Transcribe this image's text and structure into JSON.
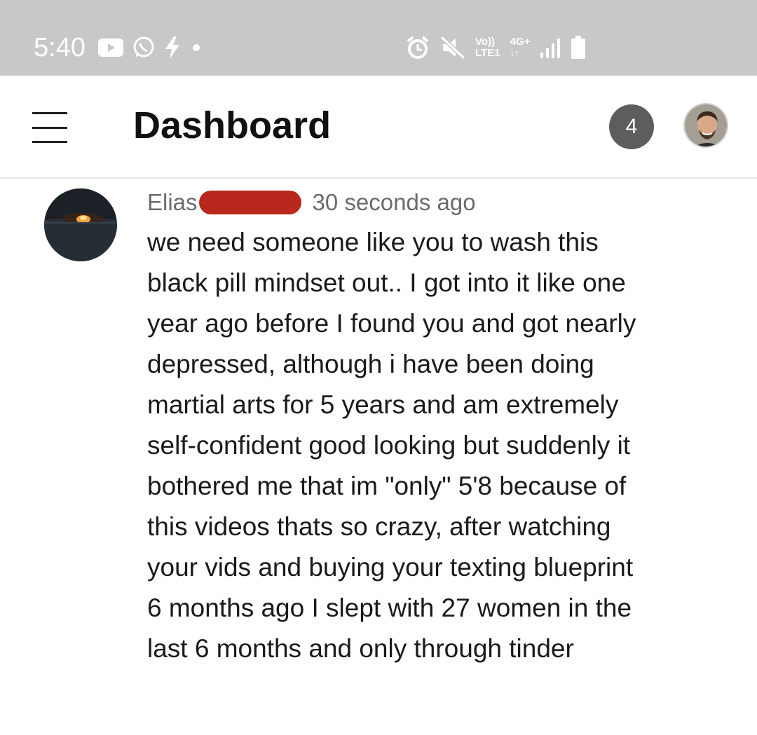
{
  "status_bar": {
    "time": "5:40",
    "icons_left": [
      "youtube-icon",
      "whatsapp-icon",
      "bolt-icon",
      "dot-icon"
    ],
    "icons_right": [
      "alarm-icon",
      "mute-icon",
      "network-icon",
      "signal-icon",
      "battery-icon"
    ],
    "volte_label": "Vo))",
    "lte_label": "LTE1",
    "network_type": "4G+"
  },
  "header": {
    "title": "Dashboard",
    "notification_count": "4"
  },
  "comment": {
    "author": "Elias",
    "time_ago": "30 seconds ago",
    "lines": [
      "we need someone like you to wash this",
      "black pill mindset out.. I got into it like one",
      "year ago before I found you and got nearly",
      "depressed, although i have been doing",
      "martial arts for 5 years and am extremely",
      "self-confident good looking but suddenly it",
      "bothered me that im \"only\" 5'8 because of",
      "this videos thats so crazy, after watching",
      "your vids and buying your texting blueprint",
      "6 months ago I slept with 27 women in the",
      "last 6 months and only through tinder"
    ]
  },
  "colors": {
    "status_bar_bg": "#c8c8c8",
    "badge_bg": "#5d5d5d",
    "redaction": "#b8281c",
    "meta_text": "#6b6b6b"
  }
}
